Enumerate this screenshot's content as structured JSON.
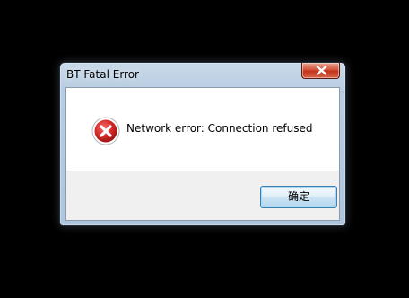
{
  "window": {
    "title": "BT Fatal Error"
  },
  "dialog": {
    "icon": "error-icon",
    "message": "Network error: Connection refused",
    "ok_label": "确定"
  },
  "colors": {
    "desktop_background": "#000000",
    "error_icon_red": "#c8242c",
    "close_button_red": "#c2331a",
    "button_border": "#3c7fb1"
  }
}
